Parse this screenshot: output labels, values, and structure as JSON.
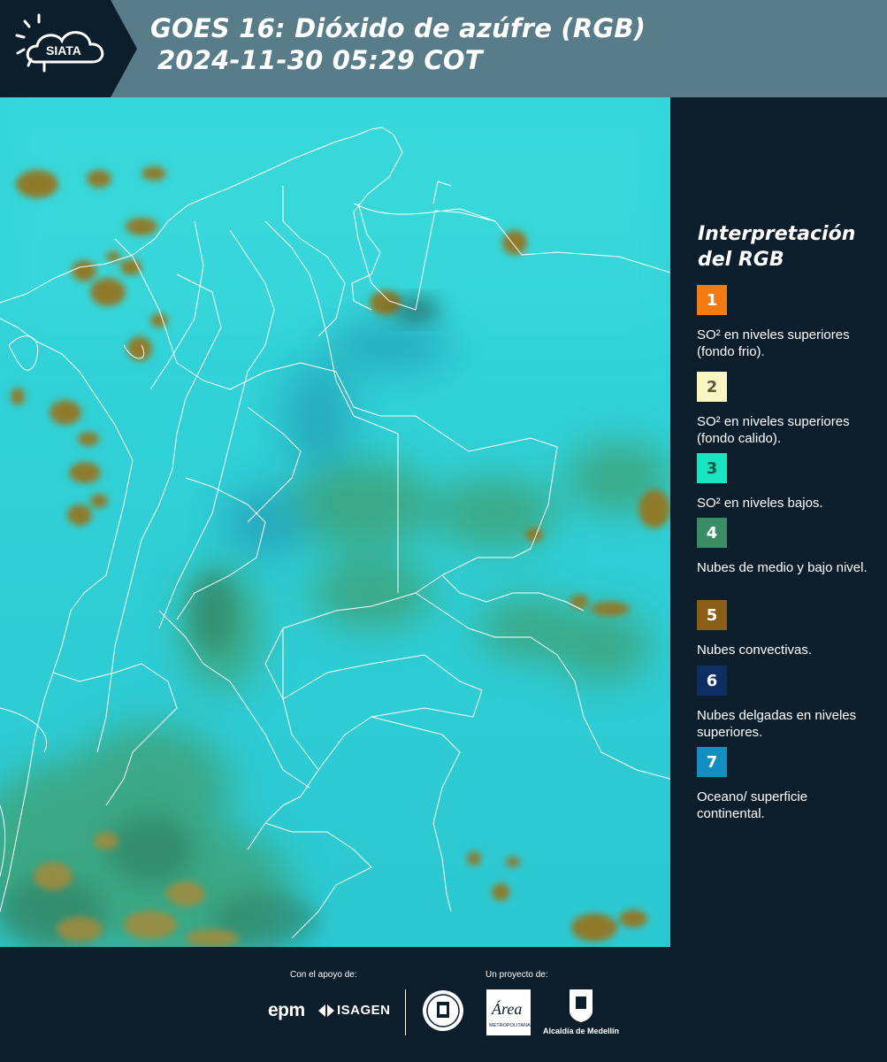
{
  "header": {
    "logo_text": "SIATA",
    "title_line1": "GOES 16: Dióxido de azúfre (RGB)",
    "title_line2": "2024-11-30 05:29 COT"
  },
  "legend": {
    "title_line1": "Interpretación",
    "title_line2": "del RGB",
    "items": [
      {
        "number": "1",
        "color": "#f27b12",
        "text_color": "#ffffff",
        "label": "SO² en niveles superiores (fondo frio)."
      },
      {
        "number": "2",
        "color": "#fbf5c4",
        "text_color": "#5a5a40",
        "label": "SO² en niveles superiores (fondo calido)."
      },
      {
        "number": "3",
        "color": "#19e4c0",
        "text_color": "#0c5c50",
        "label": "SO² en niveles bajos."
      },
      {
        "number": "4",
        "color": "#3a8c62",
        "text_color": "#ffffff",
        "label": "Nubes de medio y bajo nivel."
      },
      {
        "number": "5",
        "color": "#8a5e16",
        "text_color": "#ffffff",
        "label": "Nubes convectivas."
      },
      {
        "number": "6",
        "color": "#0e2d63",
        "text_color": "#ffffff",
        "label": "Nubes delgadas en niveles superiores."
      },
      {
        "number": "7",
        "color": "#128ec0",
        "text_color": "#ffffff",
        "label": "Oceano/ superficie continental."
      }
    ]
  },
  "footer": {
    "support_label": "Con el apoyo de:",
    "project_label": "Un proyecto de:",
    "sponsor_1": "epm",
    "sponsor_2": "ISAGEN",
    "partner_2": "Área",
    "partner_2_sub": "METROPOLITANA",
    "partner_3": "Alcaldía de Medellín"
  },
  "colors": {
    "header_bg": "#587c88",
    "panel_bg": "#0c1e2c",
    "map_background": "#2fd2d8",
    "cloud_convective": "#8a7a28",
    "cloud_low": "#3aa878"
  }
}
